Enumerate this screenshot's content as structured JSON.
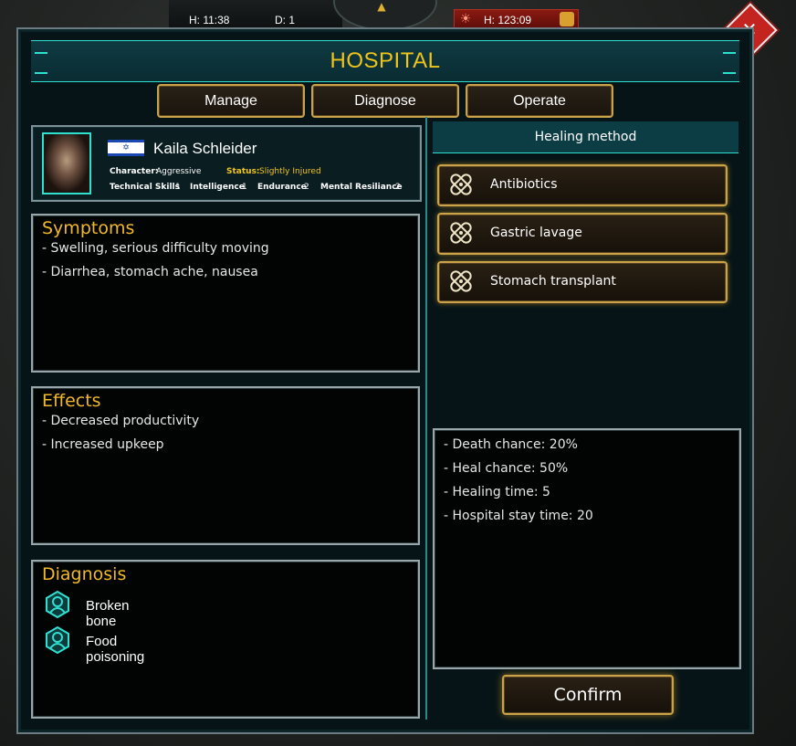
{
  "hud": {
    "time_label": "H: 11:38",
    "day_label": "D: 1",
    "alert_label": "H: 123:09"
  },
  "window": {
    "title": "HOSPITAL",
    "tabs": [
      "Manage",
      "Diagnose",
      "Operate"
    ]
  },
  "patient": {
    "name": "Kaila Schleider",
    "character_label": "Character:",
    "character_value": "Aggressive",
    "status_label": "Status:",
    "status_value": "Slightly Injured",
    "stats": [
      {
        "label": "Technical Skills",
        "value": "1"
      },
      {
        "label": "Intelligence",
        "value": "1"
      },
      {
        "label": "Endurance",
        "value": "2"
      },
      {
        "label": "Mental Resiliance",
        "value": "2"
      }
    ]
  },
  "symptoms": {
    "title": "Symptoms",
    "items": [
      "- Swelling, serious difficulty moving",
      "- Diarrhea, stomach ache, nausea"
    ]
  },
  "effects": {
    "title": "Effects",
    "items": [
      "- Decreased productivity",
      "- Increased upkeep"
    ]
  },
  "diagnosis": {
    "title": "Diagnosis",
    "items": [
      "Broken bone",
      "Food poisoning"
    ]
  },
  "healing": {
    "header": "Healing method",
    "methods": [
      "Antibiotics",
      "Gastric lavage",
      "Stomach transplant"
    ]
  },
  "details": {
    "items": [
      "- Death chance: 20%",
      "- Heal chance: 50%",
      "- Healing time: 5",
      "- Hospital stay time: 20"
    ]
  },
  "confirm_label": "Confirm",
  "colors": {
    "accent_gold": "#f0b82a",
    "accent_teal": "#2ee0d0",
    "button_border": "#c9a24a",
    "close_red": "#c42420"
  }
}
